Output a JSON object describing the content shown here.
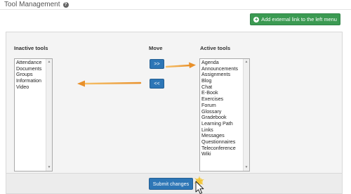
{
  "header": {
    "title": "Tool Management",
    "help_icon": "?"
  },
  "toolbar": {
    "ext_link_label": "Add external link to the left menu",
    "plus_icon": "+"
  },
  "columns": {
    "inactive": "Inactive tools",
    "move": "Move",
    "active": "Active tools"
  },
  "inactive_tools": [
    "Attendance",
    "Documents",
    "Groups",
    "Information",
    "Video"
  ],
  "active_tools": [
    "Agenda",
    "Announcements",
    "Assignments",
    "Blog",
    "Chat",
    "E-Book",
    "Exercises",
    "Forum",
    "Glossary",
    "Gradebook",
    "Learning Path",
    "Links",
    "Messages",
    "Questionnaires",
    "Teleconference",
    "Wiki"
  ],
  "move": {
    "add_label": ">>",
    "remove_label": "<<"
  },
  "submit": {
    "label": "Submit changes"
  },
  "scroll": {
    "up": "▲",
    "down": "▼"
  },
  "colors": {
    "primary": "#2d76b6",
    "success": "#3b9a52",
    "annotation_arrow": "#f0a030"
  }
}
